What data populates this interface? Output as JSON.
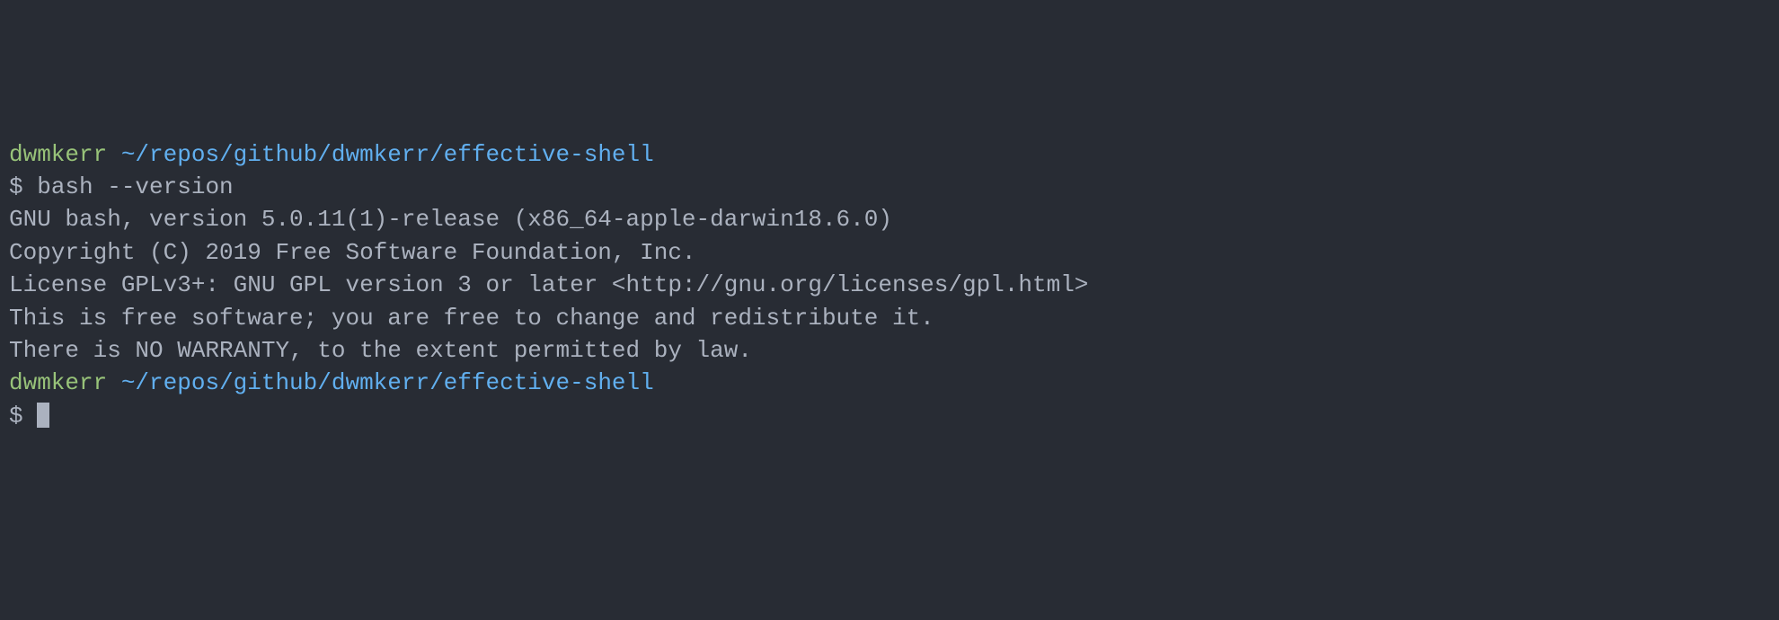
{
  "prompt1": {
    "user": "dwmkerr",
    "path": "~/repos/github/dwmkerr/effective-shell",
    "symbol": "$",
    "command": "bash --version"
  },
  "output": {
    "line1": "GNU bash, version 5.0.11(1)-release (x86_64-apple-darwin18.6.0)",
    "line2": "Copyright (C) 2019 Free Software Foundation, Inc.",
    "line3": "License GPLv3+: GNU GPL version 3 or later <http://gnu.org/licenses/gpl.html>",
    "line4": "",
    "line5": "This is free software; you are free to change and redistribute it.",
    "line6": "There is NO WARRANTY, to the extent permitted by law."
  },
  "prompt2": {
    "user": "dwmkerr",
    "path": "~/repos/github/dwmkerr/effective-shell",
    "symbol": "$"
  }
}
